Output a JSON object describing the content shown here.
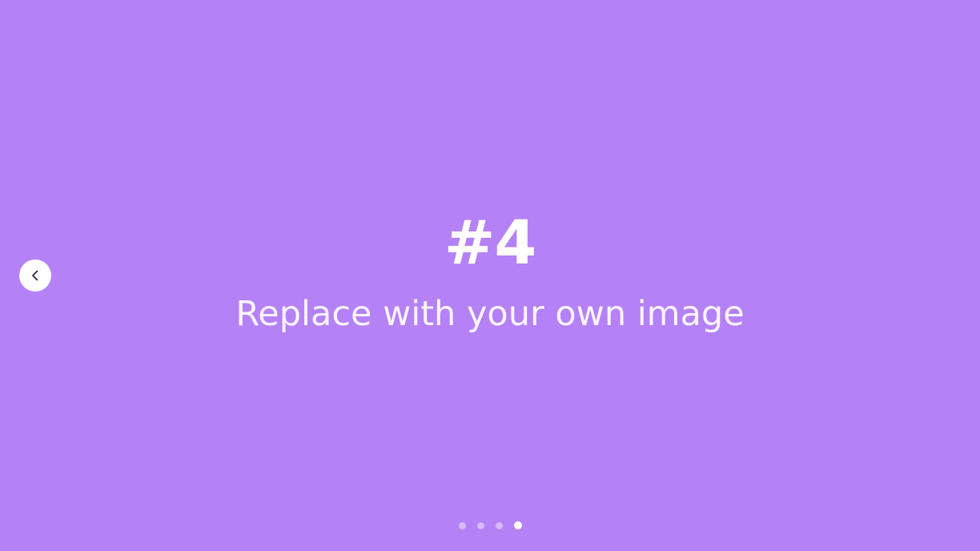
{
  "colors": {
    "background": "#B581F7",
    "text": "#FFFFFF",
    "nav_button_bg": "#FFFFFF",
    "nav_icon": "#1F1F2E"
  },
  "slide": {
    "title": "#4",
    "subtitle": "Replace with your own image"
  },
  "navigation": {
    "prev_icon": "chevron-left-icon"
  },
  "pagination": {
    "total": 4,
    "active_index": 3
  }
}
